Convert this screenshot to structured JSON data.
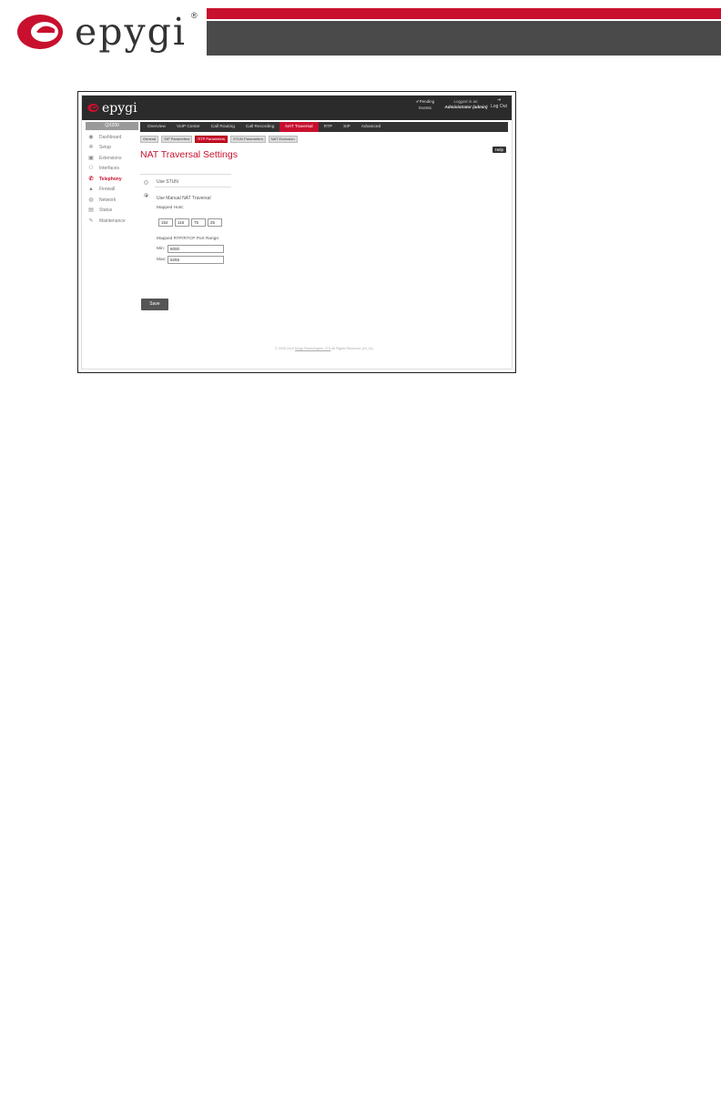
{
  "brand": {
    "name": "epygi",
    "reg": "®",
    "red": "#c8102e",
    "dark": "#4a4a4a"
  },
  "app": {
    "logo": "epygi",
    "pending_line1": "Pending",
    "pending_line2": "Events",
    "logged_in_as_label": "Logged in as:",
    "logged_in_user": "Administrator (admin)",
    "logout_label": "Log Out"
  },
  "sidebar": {
    "title": "QX200",
    "items": [
      {
        "label": "Dashboard",
        "icon": "dashboard-icon"
      },
      {
        "label": "Setup",
        "icon": "gear-icon"
      },
      {
        "label": "Extensions",
        "icon": "extension-icon"
      },
      {
        "label": "Interfaces",
        "icon": "interfaces-icon"
      },
      {
        "label": "Telephony",
        "icon": "phone-icon",
        "active": true
      },
      {
        "label": "Firewall",
        "icon": "firewall-icon"
      },
      {
        "label": "Network",
        "icon": "network-icon"
      },
      {
        "label": "Status",
        "icon": "status-icon"
      },
      {
        "label": "Maintenance",
        "icon": "wrench-icon"
      }
    ]
  },
  "tabs": [
    "Overview",
    "VoIP Center",
    "Call Routing",
    "Call Recording",
    "NAT Traversal",
    "RTP",
    "SIP",
    "Advanced"
  ],
  "active_tab": "NAT Traversal",
  "subtabs": [
    "General",
    "SIP Parameters",
    "RTP Parameters",
    "STUN Parameters",
    "NAT Exclusion"
  ],
  "active_subtab": "RTP Parameters",
  "help_label": "Help",
  "page_title": "NAT Traversal Settings",
  "form": {
    "use_stun_label": "Use STUN",
    "use_manual_label": "Use Manual NAT Traversal",
    "mapped_host_label": "Mapped Host:",
    "mapped_host": [
      "152",
      "115",
      "75",
      "25"
    ],
    "port_range_label": "Mapped RTP/RTCP Port Range:",
    "min_label": "Min:",
    "min_value": "6000",
    "max_label": "Max:",
    "max_value": "6255",
    "save_label": "Save"
  },
  "footer": {
    "pre": "© 2005-2016",
    "link": "Epygi Technologies, LTD",
    "post": "All Rights Reserved. (vn_01)"
  }
}
